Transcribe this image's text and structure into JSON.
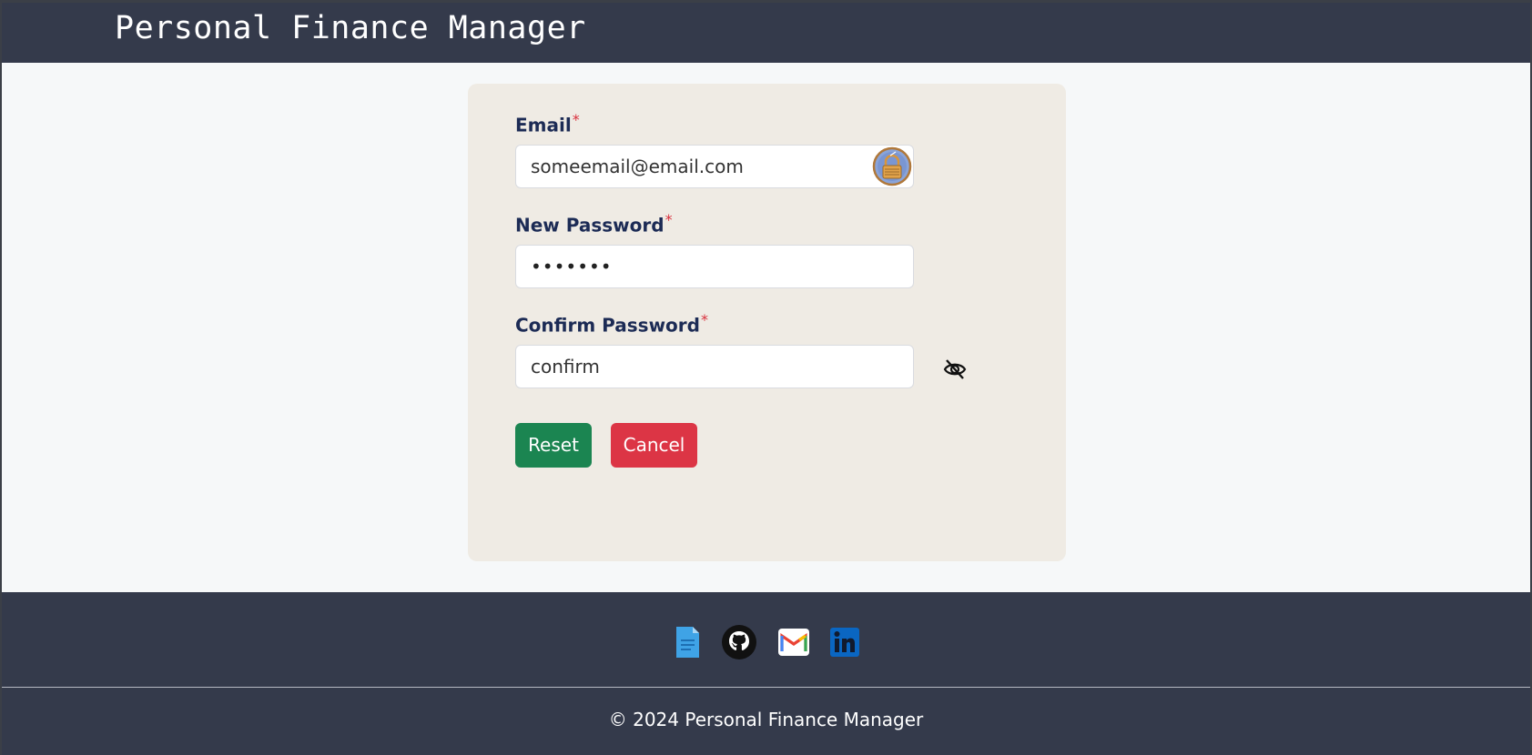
{
  "navbar": {
    "brand": "Personal Finance Manager"
  },
  "form": {
    "email": {
      "label": "Email",
      "required_mark": "*",
      "value": "someemail@email.com"
    },
    "new_password": {
      "label": "New Password",
      "required_mark": "*",
      "value": "•••••••"
    },
    "confirm_password": {
      "label": "Confirm Password",
      "required_mark": "*",
      "value": "confirm"
    },
    "buttons": {
      "reset": "Reset",
      "cancel": "Cancel"
    }
  },
  "footer": {
    "links": [
      {
        "icon": "document-icon"
      },
      {
        "icon": "github-icon"
      },
      {
        "icon": "gmail-icon"
      },
      {
        "icon": "linkedin-icon"
      }
    ],
    "copyright": "© 2024 Personal Finance Manager"
  },
  "colors": {
    "navbar_bg": "#343a4b",
    "card_bg": "#efebe4",
    "label_color": "#1c2b55",
    "required_color": "#d9303d",
    "reset_button": "#1b8551",
    "cancel_button": "#dc3545"
  }
}
